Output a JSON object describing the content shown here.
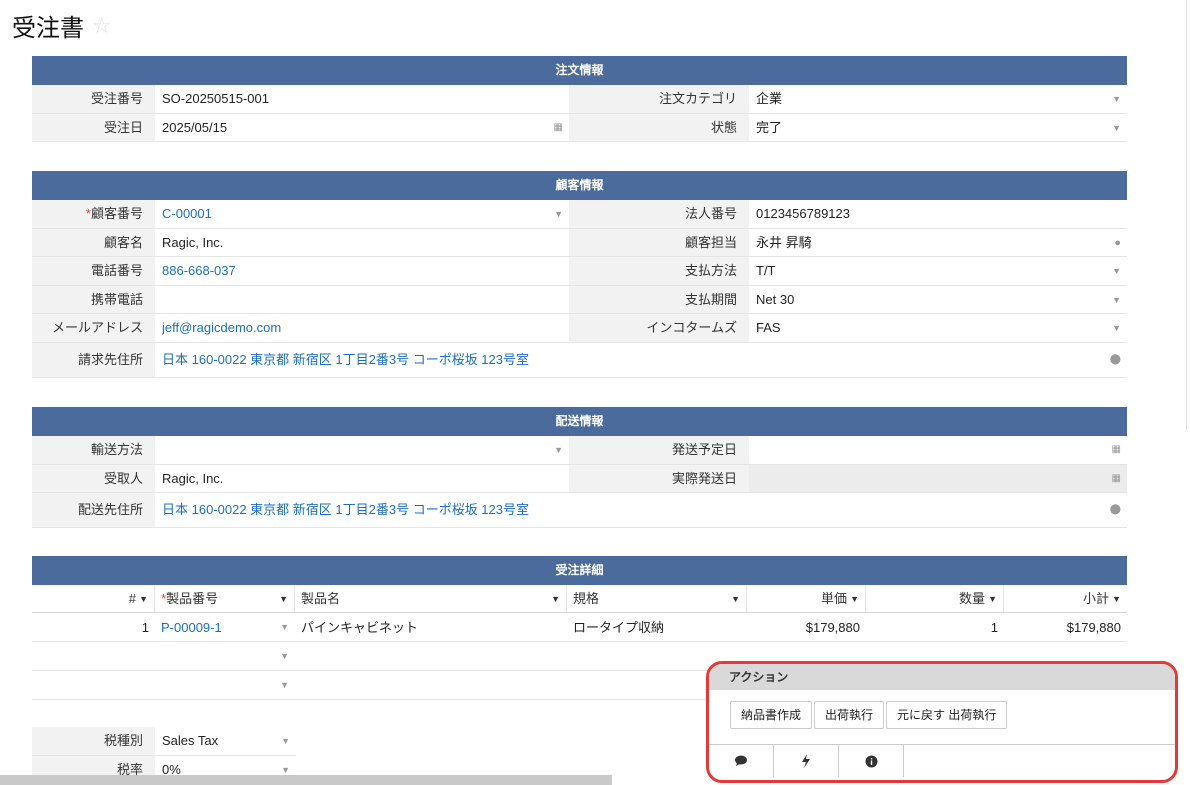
{
  "title": "受注書",
  "order": {
    "header": "注文情報",
    "order_no_label": "受注番号",
    "order_no": "SO-20250515-001",
    "category_label": "注文カテゴリ",
    "category": "企業",
    "date_label": "受注日",
    "date": "2025/05/15",
    "status_label": "状態",
    "status": "完了"
  },
  "customer": {
    "header": "顧客情報",
    "cust_no_label": "顧客番号",
    "cust_no": "C-00001",
    "corp_no_label": "法人番号",
    "corp_no": "0123456789123",
    "name_label": "顧客名",
    "name": "Ragic, Inc.",
    "rep_label": "顧客担当",
    "rep": "永井 昇騎",
    "phone_label": "電話番号",
    "phone": "886-668-037",
    "payment_label": "支払方法",
    "payment": "T/T",
    "mobile_label": "携帯電話",
    "mobile": "",
    "term_label": "支払期間",
    "term": "Net 30",
    "email_label": "メールアドレス",
    "email": "jeff@ragicdemo.com",
    "incoterms_label": "インコタームズ",
    "incoterms": "FAS",
    "bill_addr_label": "請求先住所",
    "bill_addr": "日本 160-0022 東京都 新宿区 1丁目2番3号 コーポ桜坂 123号室"
  },
  "shipping": {
    "header": "配送情報",
    "method_label": "輸送方法",
    "method": "",
    "planned_label": "発送予定日",
    "planned": "",
    "recipient_label": "受取人",
    "recipient": "Ragic, Inc.",
    "actual_label": "実際発送日",
    "actual": "",
    "ship_addr_label": "配送先住所",
    "ship_addr": "日本 160-0022 東京都 新宿区 1丁目2番3号 コーポ桜坂 123号室"
  },
  "details": {
    "header": "受注詳細",
    "cols": [
      "#",
      "製品番号",
      "製品名",
      "規格",
      "単価",
      "数量",
      "小計"
    ],
    "rows": [
      {
        "num": "1",
        "product_no": "P-00009-1",
        "product_name": "パインキャビネット",
        "spec": "ロータイプ収納",
        "price": "$179,880",
        "qty": "1",
        "subtotal": "$179,880"
      }
    ]
  },
  "tax": {
    "type_label": "税種別",
    "type": "Sales Tax",
    "rate_label": "税率",
    "rate": "0%"
  },
  "actions": {
    "header": "アクション",
    "buttons": [
      "納品書作成",
      "出荷執行",
      "元に戻す 出荷執行"
    ]
  },
  "icons": {
    "dropdown": "▼",
    "calendar": "▦",
    "user": "👤",
    "map_pin": "⬤",
    "comment": "💬",
    "bolt": "⚡",
    "info": "ℹ"
  },
  "colors": {
    "section_header": "#4a6b9b",
    "link": "#1a6fc4",
    "highlight": "#e53935"
  }
}
